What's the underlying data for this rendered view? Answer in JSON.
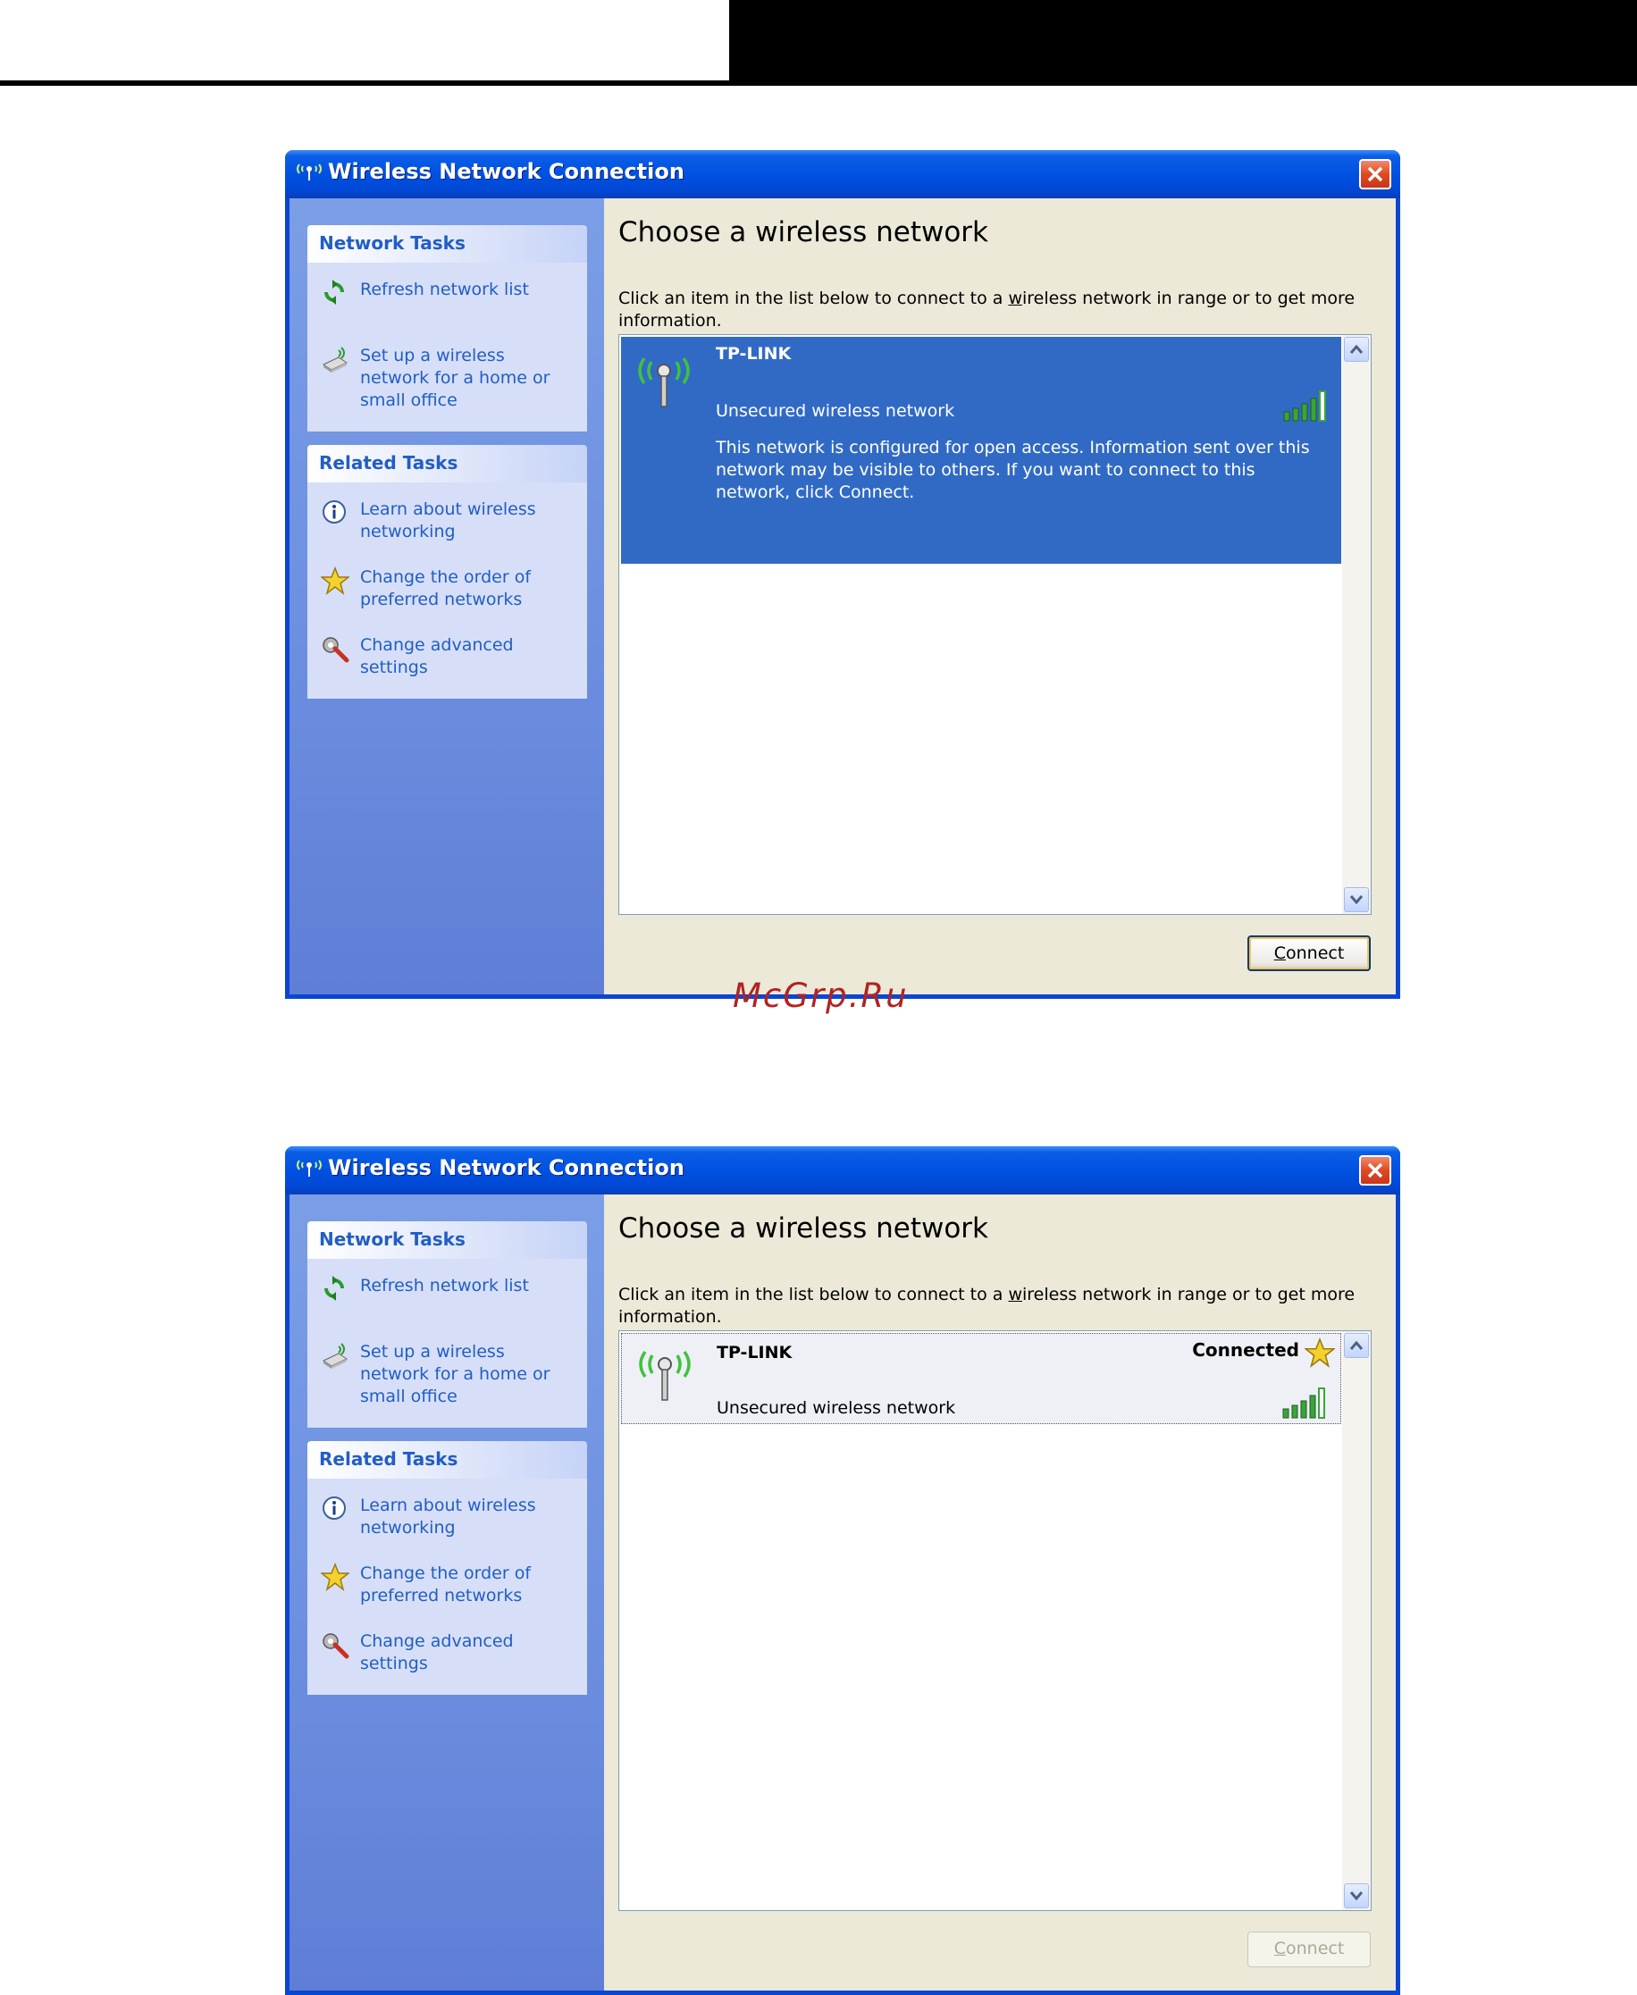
{
  "watermark": "McGrp.Ru",
  "colors": {
    "titlebar": "#0050e0",
    "selection": "#316ac5",
    "link": "#215dc6",
    "signal": "#3aa53a"
  },
  "windows": [
    {
      "title": "Wireless Network Connection",
      "network_tasks": {
        "header": "Network Tasks",
        "items": [
          {
            "icon": "refresh-icon",
            "label": "Refresh network list"
          },
          {
            "icon": "wireless-setup-icon",
            "label": "Set up a wireless network for a home or small office"
          }
        ]
      },
      "related_tasks": {
        "header": "Related Tasks",
        "items": [
          {
            "icon": "info-icon",
            "label": "Learn about wireless networking"
          },
          {
            "icon": "star-icon",
            "label": "Change the order of preferred networks"
          },
          {
            "icon": "settings-icon",
            "label": "Change advanced settings"
          }
        ]
      },
      "main": {
        "title": "Choose a wireless network",
        "description_pre": "Click an item in the list below to connect to a ",
        "description_accel": "w",
        "description_post": "ireless network in range or to get more information."
      },
      "network": {
        "name": "TP-LINK",
        "security": "Unsecured wireless network",
        "info": "This network is configured for open access. Information sent over this network may be visible to others. If you want to connect to this network, click Connect.",
        "signal_level": "5/5",
        "selected": true
      },
      "connect_button": {
        "accel": "C",
        "rest": "onnect",
        "enabled": true
      }
    },
    {
      "title": "Wireless Network Connection",
      "network_tasks": {
        "header": "Network Tasks",
        "items": [
          {
            "icon": "refresh-icon",
            "label": "Refresh network list"
          },
          {
            "icon": "wireless-setup-icon",
            "label": "Set up a wireless network for a home or small office"
          }
        ]
      },
      "related_tasks": {
        "header": "Related Tasks",
        "items": [
          {
            "icon": "info-icon",
            "label": "Learn about wireless networking"
          },
          {
            "icon": "star-icon",
            "label": "Change the order of preferred networks"
          },
          {
            "icon": "settings-icon",
            "label": "Change advanced settings"
          }
        ]
      },
      "main": {
        "title": "Choose a wireless network",
        "description_pre": "Click an item in the list below to connect to a ",
        "description_accel": "w",
        "description_post": "ireless network in range or to get more information."
      },
      "network": {
        "name": "TP-LINK",
        "status": "Connected",
        "security": "Unsecured wireless network",
        "signal_level": "5/5",
        "selected": false
      },
      "connect_button": {
        "accel": "C",
        "rest": "onnect",
        "enabled": false
      }
    }
  ]
}
